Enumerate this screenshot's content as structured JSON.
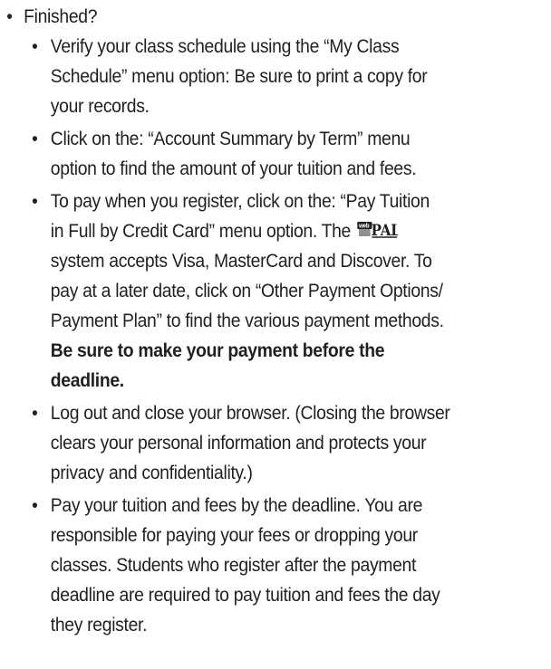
{
  "list": {
    "heading": "Finished?",
    "items": [
      {
        "lines": [
          "Verify your class schedule using the “My Class",
          "Schedule” menu option: Be sure to print a copy for",
          "your records."
        ]
      },
      {
        "lines": [
          "Click on the: “Account Summary by Term” menu",
          "option to find the amount of your tuition and fees."
        ]
      },
      {
        "line1": "To pay when you register, click on the: “Pay Tuition",
        "line2_before_logo": "in Full by Credit Card” menu option. The",
        "logo_text": "webPAL",
        "line3": "system accepts Visa, MasterCard and Discover. To",
        "line4": "pay at a later date, click on “Other Payment Options/",
        "line5": "Payment Plan” to find the various payment methods.",
        "bold_line1": "Be sure to make your payment before the",
        "bold_line2": "deadline."
      },
      {
        "lines": [
          "Log out and close your browser. (Closing the browser",
          "clears your personal information and protects your",
          "privacy and confidentiality.)"
        ]
      },
      {
        "lines": [
          "Pay your tuition and fees by the deadline. You are",
          "responsible for paying your fees or dropping your",
          "classes. Students who register after the payment",
          "deadline are required to pay tuition and fees the day",
          "they register."
        ]
      }
    ]
  }
}
